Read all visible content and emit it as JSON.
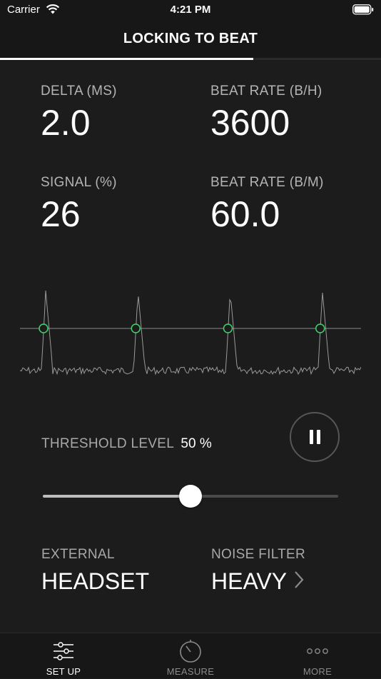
{
  "status_bar": {
    "carrier": "Carrier",
    "time": "4:21 PM",
    "wifi_icon": "wifi-icon",
    "battery_icon": "battery-icon"
  },
  "nav": {
    "title": "LOCKING TO BEAT",
    "progress_fraction": 0.665
  },
  "metrics": [
    {
      "label": "DELTA (MS)",
      "value": "2.0"
    },
    {
      "label": "BEAT RATE (B/H)",
      "value": "3600"
    },
    {
      "label": "SIGNAL (%)",
      "value": "26"
    },
    {
      "label": "BEAT RATE (B/M)",
      "value": "60.0"
    }
  ],
  "waveform": {
    "beat_marker_count": 4,
    "colors": {
      "trace": "#9a9a9a",
      "baseline": "#8a8a8a",
      "marker": "#3fd56b"
    }
  },
  "threshold": {
    "label": "THRESHOLD LEVEL",
    "value_text": "50 %",
    "level_fraction": 0.5
  },
  "pause_button": {
    "icon": "pause-icon"
  },
  "settings": [
    {
      "label": "EXTERNAL",
      "value": "HEADSET",
      "has_chevron": false
    },
    {
      "label": "NOISE FILTER",
      "value": "HEAVY",
      "has_chevron": true,
      "icon": "chevron-right-icon"
    }
  ],
  "tabs": [
    {
      "label": "SET UP",
      "icon": "sliders-icon",
      "active": true
    },
    {
      "label": "MEASURE",
      "icon": "stopwatch-icon",
      "active": false
    },
    {
      "label": "MORE",
      "icon": "more-dots-icon",
      "active": false
    }
  ],
  "colors": {
    "background": "#1c1c1c",
    "bars": "#171717",
    "accent_green": "#3fd56b"
  }
}
